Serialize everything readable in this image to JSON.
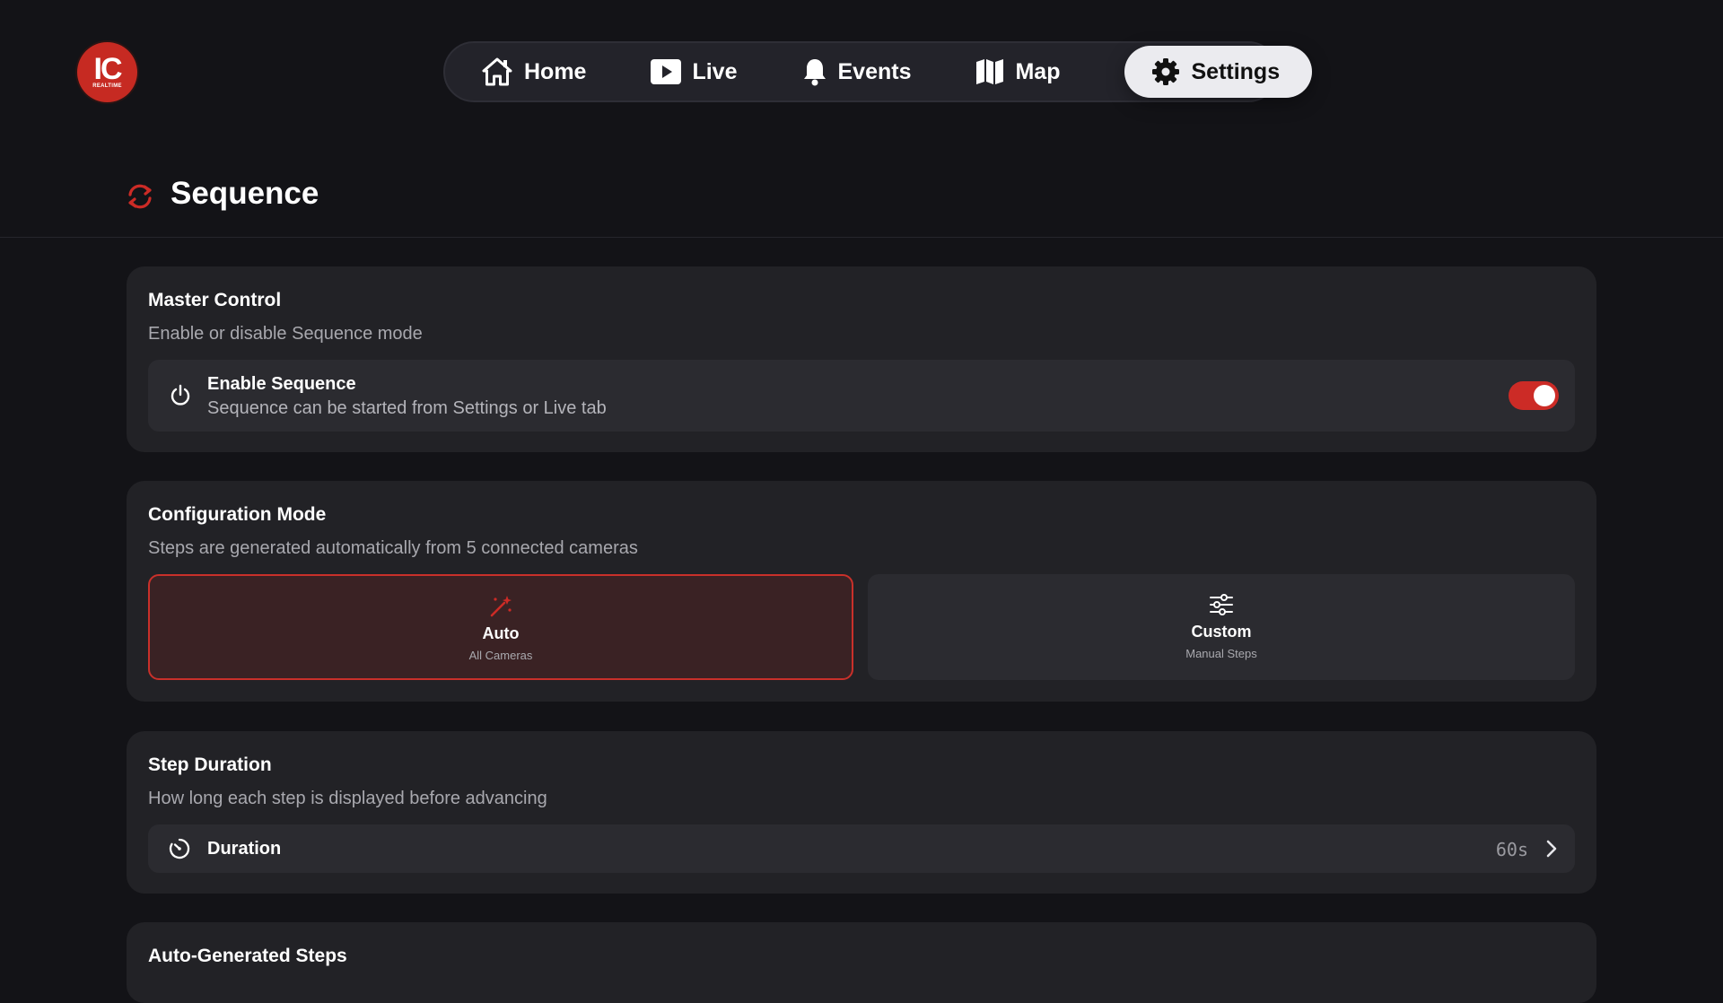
{
  "logo": {
    "main": "IC",
    "sub": "REALTIME"
  },
  "nav": {
    "items": [
      {
        "label": "Home",
        "icon": "home-icon"
      },
      {
        "label": "Live",
        "icon": "play-icon"
      },
      {
        "label": "Events",
        "icon": "bell-icon"
      },
      {
        "label": "Map",
        "icon": "map-icon"
      },
      {
        "label": "Settings",
        "icon": "gear-icon",
        "active": true
      }
    ]
  },
  "page": {
    "title": "Sequence",
    "icon": "sync-icon"
  },
  "master": {
    "title": "Master Control",
    "subtitle": "Enable or disable Sequence mode",
    "row_title": "Enable Sequence",
    "row_sub": "Sequence can be started from Settings or Live tab",
    "enabled": true
  },
  "config": {
    "title": "Configuration Mode",
    "subtitle": "Steps are generated automatically from 5 connected cameras",
    "selected": "auto",
    "auto": {
      "title": "Auto",
      "sub": "All Cameras"
    },
    "custom": {
      "title": "Custom",
      "sub": "Manual Steps"
    }
  },
  "duration": {
    "title": "Step Duration",
    "subtitle": "How long each step is displayed before advancing",
    "label": "Duration",
    "value": "60s"
  },
  "auto_steps": {
    "title": "Auto-Generated Steps"
  },
  "colors": {
    "accent": "#cc2b26",
    "background": "#131317",
    "card": "#222226",
    "row": "#2b2b30",
    "selected_bg": "#3a2224"
  }
}
